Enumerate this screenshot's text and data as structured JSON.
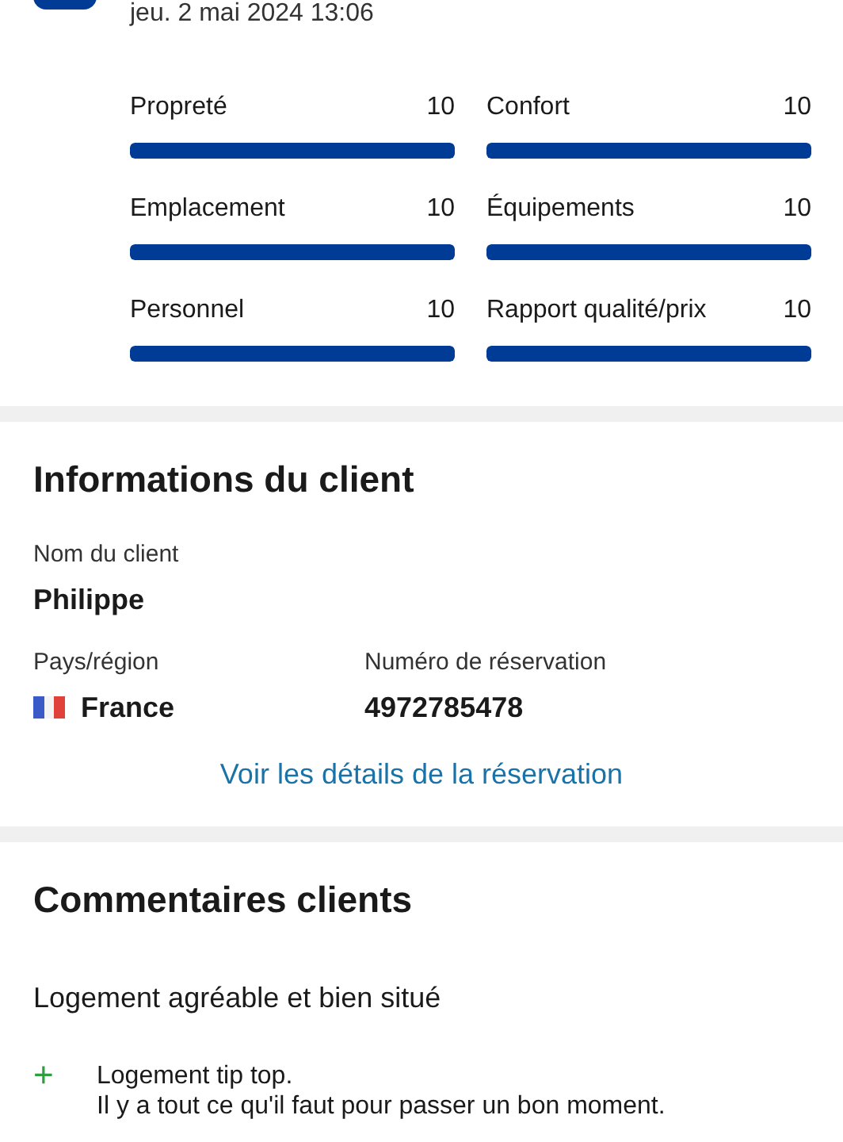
{
  "review_header": {
    "date": "jeu. 2 mai 2024 13:06"
  },
  "ratings": [
    {
      "label": "Propreté",
      "score": "10",
      "level": 1
    },
    {
      "label": "Confort",
      "score": "10",
      "level": 1
    },
    {
      "label": "Emplacement",
      "score": "10",
      "level": 1
    },
    {
      "label": "Équipements",
      "score": "10",
      "level": 1
    },
    {
      "label": "Personnel",
      "score": "10",
      "level": 1
    },
    {
      "label": "Rapport qualité/prix",
      "score": "10",
      "level": 1
    }
  ],
  "guest_info": {
    "title": "Informations du client",
    "name_label": "Nom du client",
    "name": "Philippe",
    "country_label": "Pays/région",
    "country": "France",
    "booking_label": "Numéro de réservation",
    "booking_number": "4972785478",
    "link": "Voir les détails de la réservation"
  },
  "comments": {
    "title": "Commentaires clients",
    "review_title": "Logement agréable et bien situé",
    "positive": {
      "sign": "+",
      "lines": [
        "Logement tip top.",
        "Il y a tout ce qu'il faut pour passer un bon moment."
      ]
    }
  }
}
